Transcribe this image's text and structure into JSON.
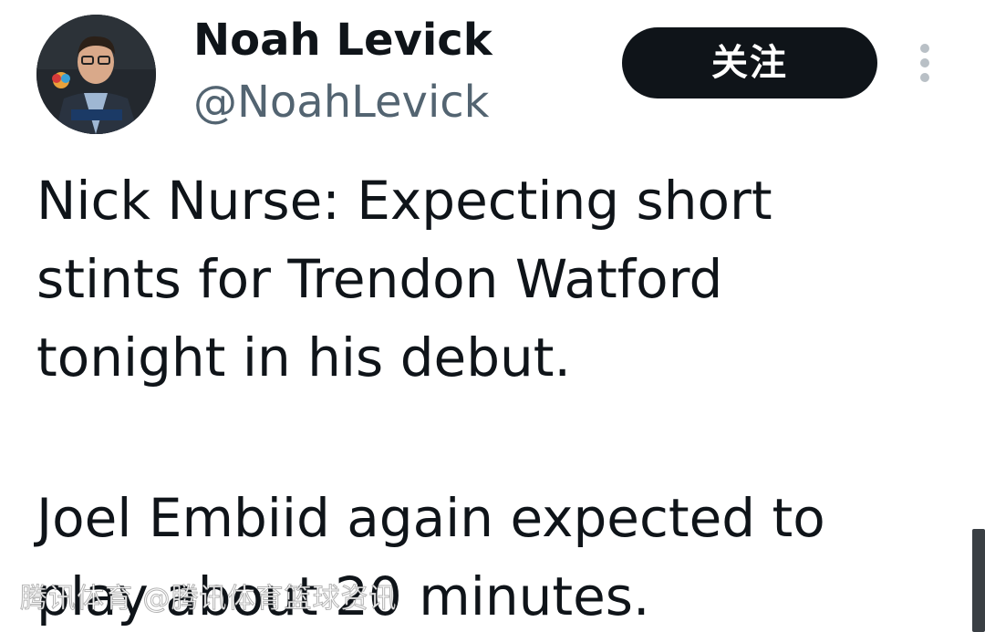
{
  "profile": {
    "display_name": "Noah Levick",
    "handle": "@NoahLevick",
    "avatar_icon": "person-avatar-icon"
  },
  "actions": {
    "follow_label": "关注",
    "more_icon": "more-vertical-icon"
  },
  "tweet": {
    "lines": [
      "Nick Nurse: Expecting short",
      "stints for Trendon Watford",
      "tonight in his debut.",
      "Joel Embiid again expected to",
      "play about 20 minutes."
    ]
  },
  "watermark": {
    "text": "腾讯体育 @腾讯体育篮球资讯"
  },
  "colors": {
    "text": "#0f1419",
    "secondary": "#536471",
    "button_bg": "#0f1419",
    "button_text": "#ffffff"
  }
}
